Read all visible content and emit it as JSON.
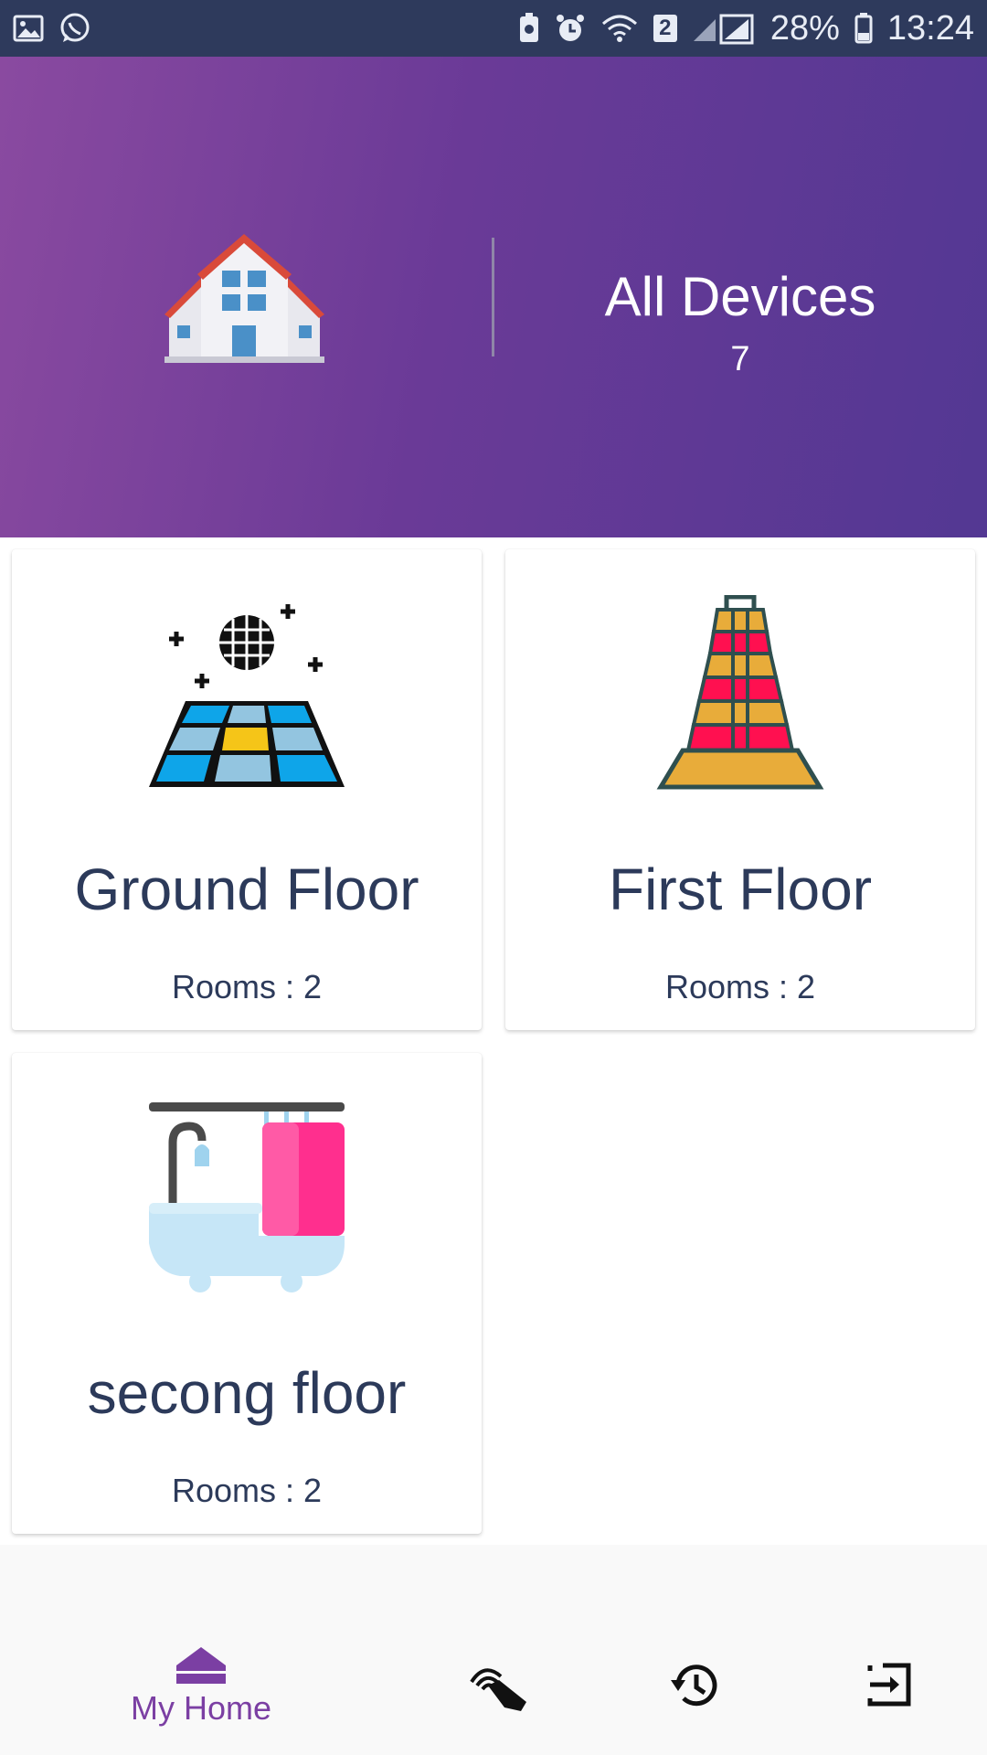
{
  "status_bar": {
    "battery": "28%",
    "time": "13:24",
    "sim_badge": "2",
    "icons": [
      "image-icon",
      "whatsapp-icon",
      "battery-saver-icon",
      "alarm-icon",
      "wifi-icon",
      "signal-icon",
      "battery-icon"
    ]
  },
  "header": {
    "icon": "house-icon",
    "title": "All Devices",
    "count": "7"
  },
  "floors": [
    {
      "name": "Ground Floor",
      "rooms": "Rooms : 2",
      "icon": "dance-floor-icon"
    },
    {
      "name": "First Floor",
      "rooms": "Rooms : 2",
      "icon": "tower-icon"
    },
    {
      "name": "secong floor",
      "rooms": "Rooms : 2",
      "icon": "bathroom-icon"
    }
  ],
  "bottom_nav": {
    "home_label": "My Home",
    "icons": [
      "home-icon",
      "touch-control-icon",
      "history-icon",
      "logout-icon"
    ],
    "active_color": "#7b3fa3"
  },
  "colors": {
    "status_bar": "#2e3a5c",
    "hero_start": "#8a4aa0",
    "hero_end": "#533893",
    "text_dark": "#2c3a5a"
  }
}
